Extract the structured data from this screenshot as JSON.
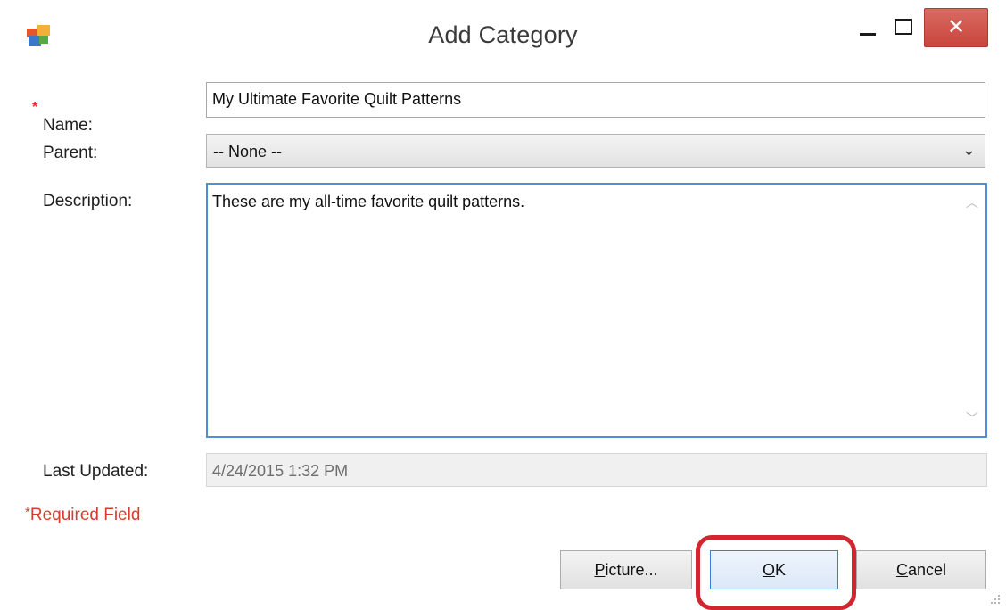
{
  "window": {
    "title": "Add Category",
    "close_glyph": "✕",
    "icon": "app-icon"
  },
  "form": {
    "name_label": "Name:",
    "name_value": "My Ultimate Favorite Quilt Patterns",
    "parent_label": "Parent:",
    "parent_value": "-- None --",
    "description_label": "Description:",
    "description_value": "These are my all-time favorite quilt patterns.",
    "last_updated_label": "Last Updated:",
    "last_updated_value": "4/24/2015 1:32 PM",
    "required_star": "*",
    "required_text": "Required Field"
  },
  "buttons": {
    "picture_mnemonic": "P",
    "picture_rest": "icture...",
    "ok_mnemonic": "O",
    "ok_rest": "K",
    "cancel_mnemonic": "C",
    "cancel_rest": "ancel"
  },
  "colors": {
    "accent_focus": "#4f8fd6",
    "required": "#d83a2e",
    "close_button": "#c9453c",
    "annotation_ring": "#d02630"
  }
}
